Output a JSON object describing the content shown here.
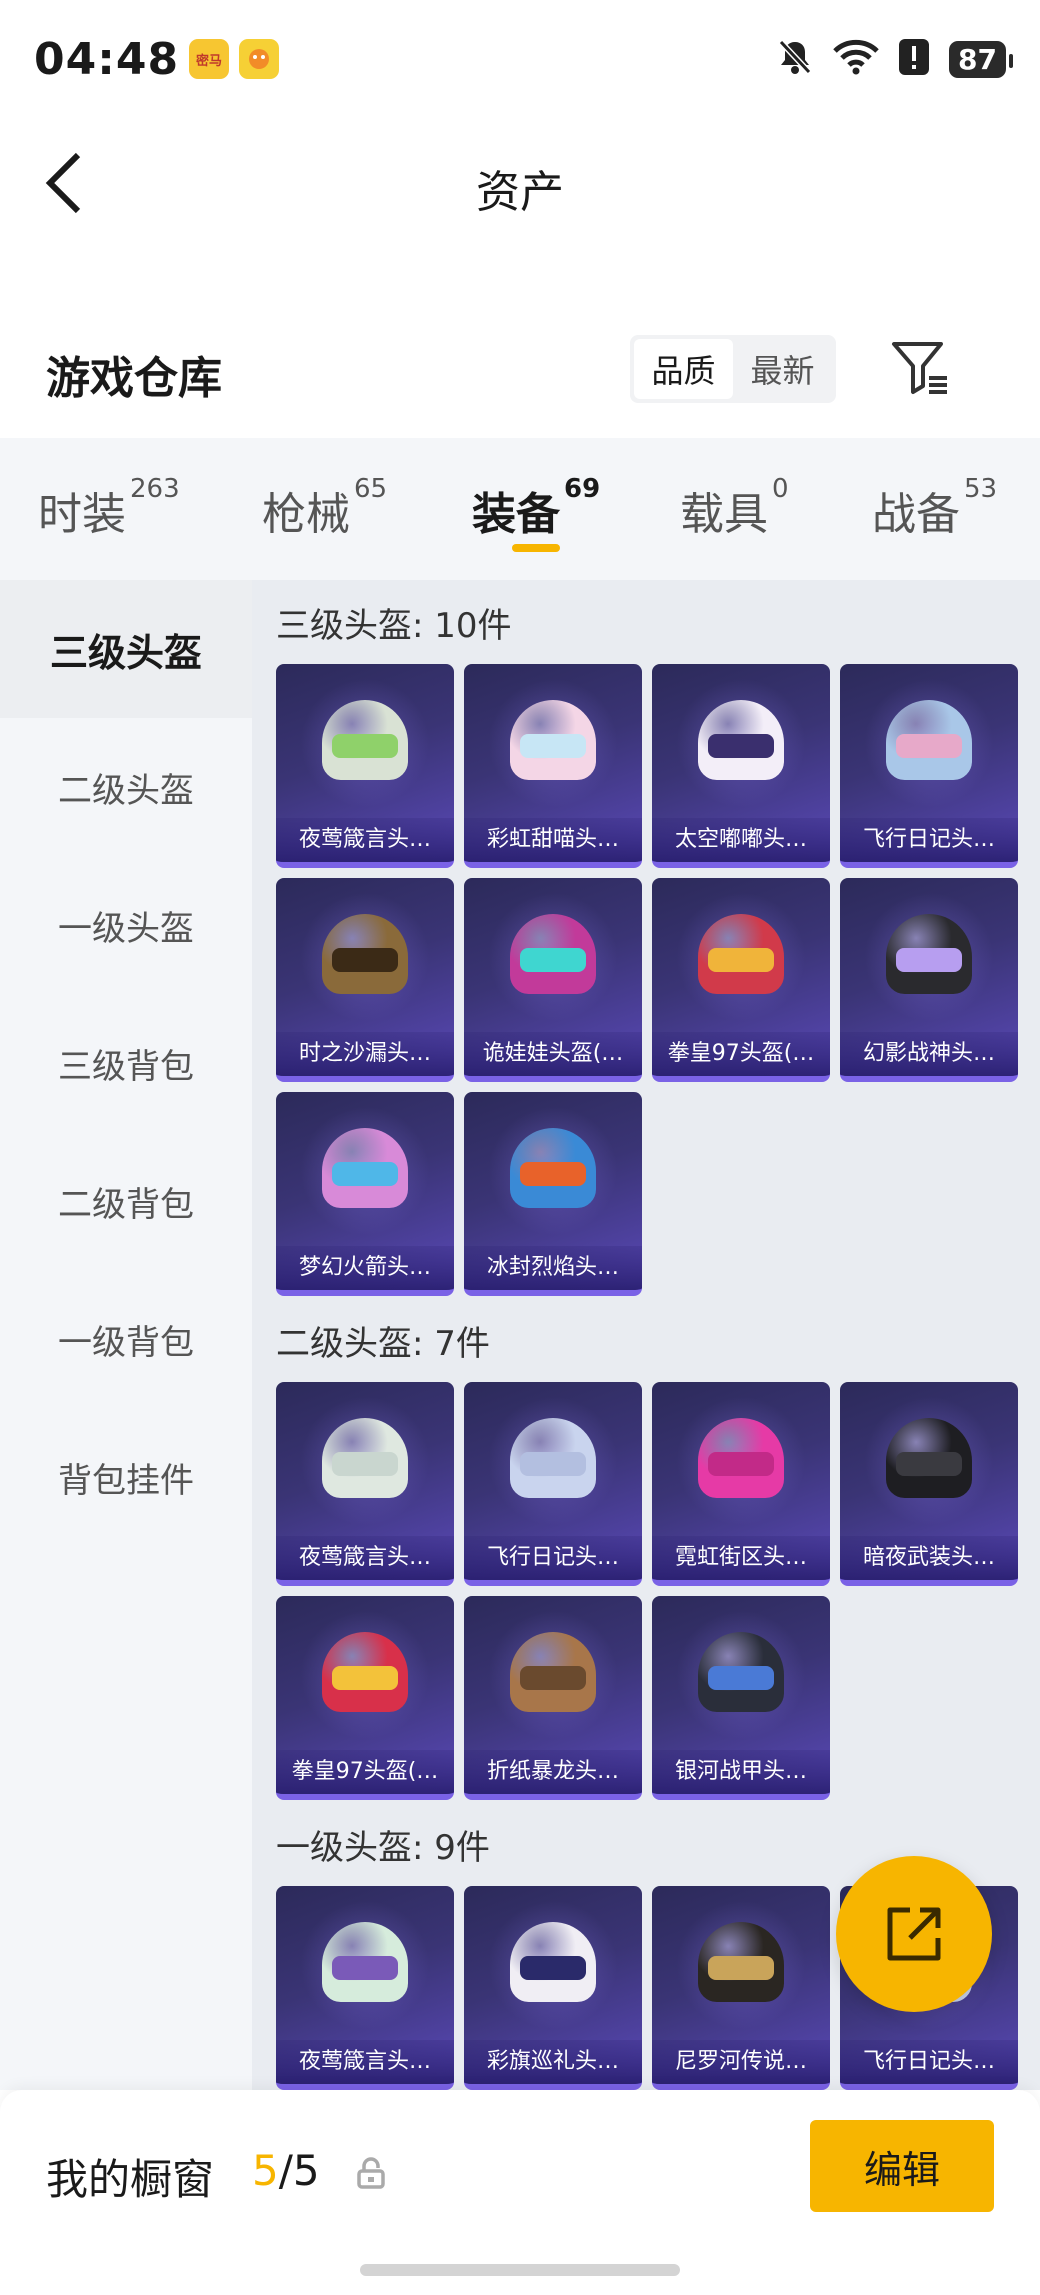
{
  "status_bar": {
    "time": "04:48",
    "app_badges": [
      "密马",
      ""
    ],
    "battery": "87"
  },
  "header": {
    "title": "资产"
  },
  "warehouse": {
    "title": "游戏仓库",
    "sort_options": [
      "品质",
      "最新"
    ],
    "active_sort": "品质"
  },
  "tabs": [
    {
      "label": "时装",
      "count": "263"
    },
    {
      "label": "枪械",
      "count": "65"
    },
    {
      "label": "装备",
      "count": "69"
    },
    {
      "label": "载具",
      "count": "0"
    },
    {
      "label": "战备",
      "count": "53"
    }
  ],
  "active_tab": "装备",
  "side_nav": [
    {
      "label": "三级头盔"
    },
    {
      "label": "二级头盔"
    },
    {
      "label": "一级头盔"
    },
    {
      "label": "三级背包"
    },
    {
      "label": "二级背包"
    },
    {
      "label": "一级背包"
    },
    {
      "label": "背包挂件"
    }
  ],
  "sections": [
    {
      "title": "三级头盔: 10件",
      "items": [
        {
          "name": "夜莺箴言头…",
          "color": "#d9e2d4",
          "visor": "#8fd16a"
        },
        {
          "name": "彩虹甜喵头…",
          "color": "#f4d6e6",
          "visor": "#c7e6f5"
        },
        {
          "name": "太空嘟嘟头…",
          "color": "#f3eef8",
          "visor": "#3a2f6e"
        },
        {
          "name": "飞行日记头…",
          "color": "#a9c7e8",
          "visor": "#e7a9c9"
        },
        {
          "name": "时之沙漏头…",
          "color": "#8a6a3a",
          "visor": "#3b2a16"
        },
        {
          "name": "诡娃娃头盔(…",
          "color": "#c23a9a",
          "visor": "#3fd6d0"
        },
        {
          "name": "拳皇97头盔(…",
          "color": "#d13a4a",
          "visor": "#f0b43a"
        },
        {
          "name": "幻影战神头…",
          "color": "#2a2a2e",
          "visor": "#b79ef0"
        },
        {
          "name": "梦幻火箭头…",
          "color": "#d88ad8",
          "visor": "#4fb7e8"
        },
        {
          "name": "冰封烈焰头…",
          "color": "#3a8ad6",
          "visor": "#e8622a"
        }
      ]
    },
    {
      "title": "二级头盔: 7件",
      "items": [
        {
          "name": "夜莺箴言头…",
          "color": "#dfe8e0",
          "visor": "#c9d6cf"
        },
        {
          "name": "飞行日记头…",
          "color": "#c9d4ee",
          "visor": "#b3bfe0"
        },
        {
          "name": "霓虹街区头…",
          "color": "#e63aa6",
          "visor": "#c22a88"
        },
        {
          "name": "暗夜武装头…",
          "color": "#1e1e22",
          "visor": "#3a3a40"
        },
        {
          "name": "拳皇97头盔(…",
          "color": "#d8304a",
          "visor": "#f3c23a"
        },
        {
          "name": "折纸暴龙头…",
          "color": "#a8764a",
          "visor": "#6a4a2e"
        },
        {
          "name": "银河战甲头…",
          "color": "#2a2e3a",
          "visor": "#4a7ad6"
        }
      ]
    },
    {
      "title": "一级头盔: 9件",
      "items": [
        {
          "name": "夜莺箴言头…",
          "color": "#d6ecdc",
          "visor": "#7a5ab8"
        },
        {
          "name": "彩旗巡礼头…",
          "color": "#f0eef4",
          "visor": "#2a2a6a"
        },
        {
          "name": "尼罗河传说…",
          "color": "#2a2622",
          "visor": "#c9a45a"
        },
        {
          "name": "飞行日记头…",
          "color": "#c9d4ee",
          "visor": "#e7c9a9"
        }
      ]
    }
  ],
  "showcase": {
    "label": "我的橱窗",
    "current": "5",
    "separator": "/",
    "total": "5",
    "edit_label": "编辑"
  },
  "colors": {
    "accent": "#f7b500",
    "card_bg": "#3a3475",
    "card_border": "#7a62e6"
  }
}
